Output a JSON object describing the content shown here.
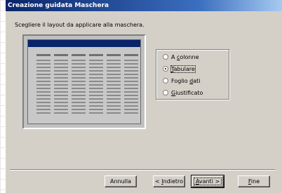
{
  "window": {
    "title": "Creazione guidata Maschera"
  },
  "instruction": "Scegliere il layout da applicare alla maschera.",
  "layout_options": [
    {
      "label_pre": "A ",
      "label_u": "c",
      "label_post": "olonne",
      "selected": false
    },
    {
      "label_pre": "",
      "label_u": "T",
      "label_post": "abulare",
      "selected": true
    },
    {
      "label_pre": "Foglio ",
      "label_u": "d",
      "label_post": "ati",
      "selected": false
    },
    {
      "label_pre": "",
      "label_u": "G",
      "label_post": "iustificato",
      "selected": false
    }
  ],
  "buttons": {
    "cancel": "Annulla",
    "back_pre": "< ",
    "back_u": "I",
    "back_post": "ndietro",
    "next_u": "A",
    "next_post": "vanti >",
    "finish_u": "F",
    "finish_post": "ine"
  }
}
